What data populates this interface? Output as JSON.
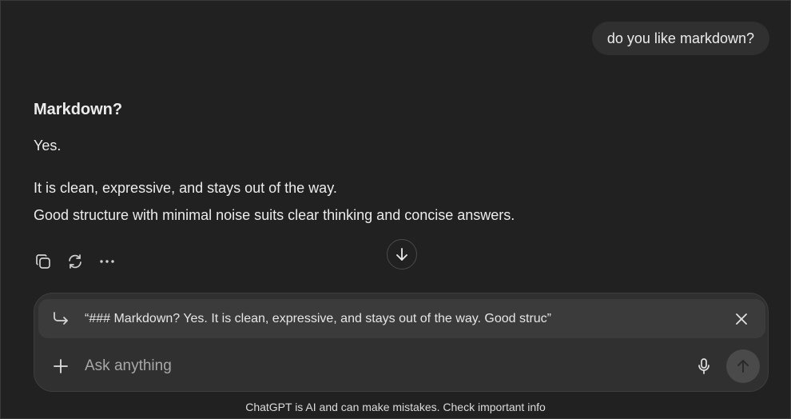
{
  "conversation": {
    "user_message": "do you like markdown?",
    "assistant": {
      "heading": "Markdown?",
      "line1": "Yes.",
      "line2": "It is clean, expressive, and stays out of the way.",
      "line3": "Good structure with minimal noise suits clear thinking and concise answers."
    }
  },
  "actions": {
    "copy_icon": "copy-icon",
    "regenerate_icon": "refresh-icon",
    "more_icon": "more-icon"
  },
  "composer": {
    "quote_text": "“### Markdown? Yes. It is clean, expressive, and stays out of the way. Good struc”",
    "placeholder": "Ask anything"
  },
  "footer": {
    "disclaimer": "ChatGPT is AI and can make mistakes. Check important info"
  },
  "colors": {
    "background": "#212121",
    "bubble": "#303030",
    "composer": "#303030",
    "quote_bar": "#3b3b3b",
    "send_button": "#4a4a4a"
  }
}
